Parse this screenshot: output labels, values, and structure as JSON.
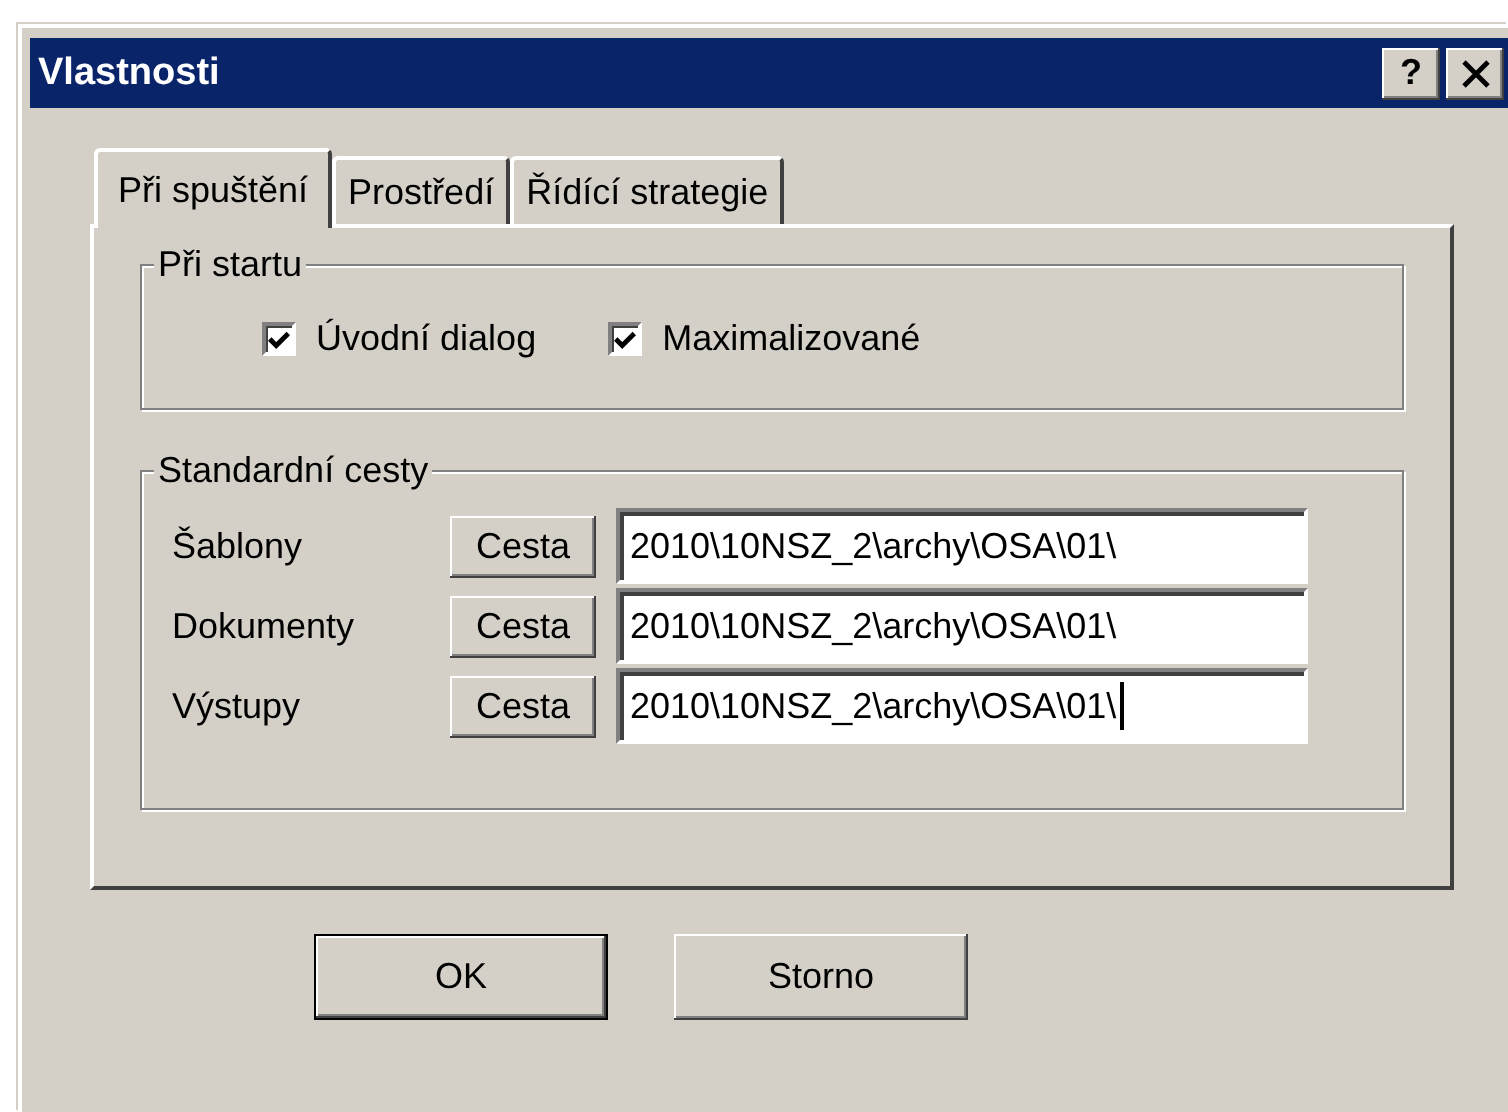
{
  "window": {
    "title": "Vlastnosti",
    "help_button": "?"
  },
  "tabs": [
    {
      "label": "Při spuštění",
      "selected": true
    },
    {
      "label": "Prostředí",
      "selected": false
    },
    {
      "label": "Řídící strategie",
      "selected": false
    }
  ],
  "startup_group": {
    "title": "Při startu",
    "checkboxes": [
      {
        "label": "Úvodní dialog",
        "checked": true
      },
      {
        "label": "Maximalizované",
        "checked": true
      }
    ]
  },
  "paths_group": {
    "title": "Standardní cesty",
    "rows": [
      {
        "label": "Šablony",
        "button": "Cesta",
        "value": "2010\\10NSZ_2\\archy\\OSA\\01\\",
        "focused": false
      },
      {
        "label": "Dokumenty",
        "button": "Cesta",
        "value": "2010\\10NSZ_2\\archy\\OSA\\01\\",
        "focused": false
      },
      {
        "label": "Výstupy",
        "button": "Cesta",
        "value": "2010\\10NSZ_2\\archy\\OSA\\01\\",
        "focused": true
      }
    ]
  },
  "buttons": [
    {
      "label": "OK",
      "default": true
    },
    {
      "label": "Storno",
      "default": false
    }
  ]
}
